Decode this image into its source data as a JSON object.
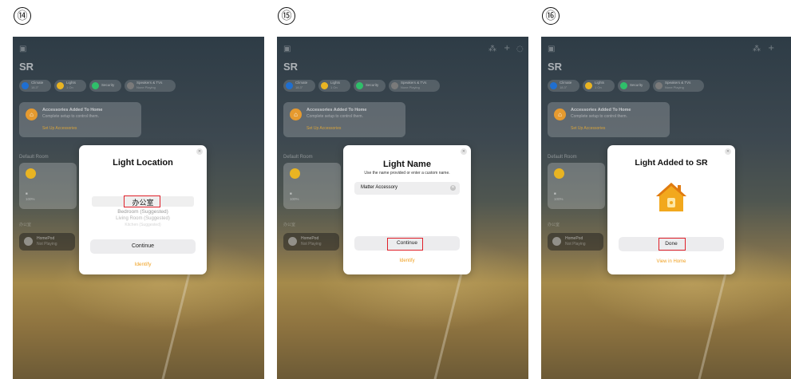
{
  "steps": [
    "⑭",
    "⑮",
    "⑯"
  ],
  "home": {
    "title": "SR",
    "chips": [
      {
        "icon": "climate-icon",
        "label": "Climate",
        "sub": "18.3°",
        "color": "#1f6fd1"
      },
      {
        "icon": "lights-icon",
        "label": "Lights",
        "sub": "1 On",
        "color": "#e9b422"
      },
      {
        "icon": "security-icon",
        "label": "Security",
        "sub": "",
        "color": "#2fbf6a"
      },
      {
        "icon": "speakers-icon",
        "label": "Speakers & TVs",
        "sub": "None Playing",
        "color": "#7a7a7a"
      }
    ],
    "notice": {
      "title": "Accessories Added To Home",
      "subtitle": "Complete setup to control them.",
      "link": "Set Up Accessories"
    },
    "room_label": "Default Room",
    "tile": {
      "line1": "",
      "line2": "100%"
    },
    "room2_label": "办公室",
    "homepod": {
      "name": "HomePod",
      "status": "Not Playing"
    }
  },
  "panels": [
    {
      "dialog_title": "Light Location",
      "picker": {
        "selected": "办公室",
        "option1": "Bedroom (Suggested)",
        "option2": "Living Room (Suggested)",
        "option3": "Kitchen (Suggested)"
      },
      "primary_button": "Continue",
      "secondary_link": "Identify"
    },
    {
      "dialog_title": "Light Name",
      "hint": "Use the name provided or enter a custom name.",
      "name_value": "Matter Accessory",
      "primary_button": "Continue",
      "secondary_link": "Identify"
    },
    {
      "dialog_title": "Light Added to SR",
      "primary_button": "Done",
      "secondary_link": "View in Home"
    }
  ],
  "colors": {
    "accent": "#f0a020",
    "highlight": "#e0202a"
  }
}
